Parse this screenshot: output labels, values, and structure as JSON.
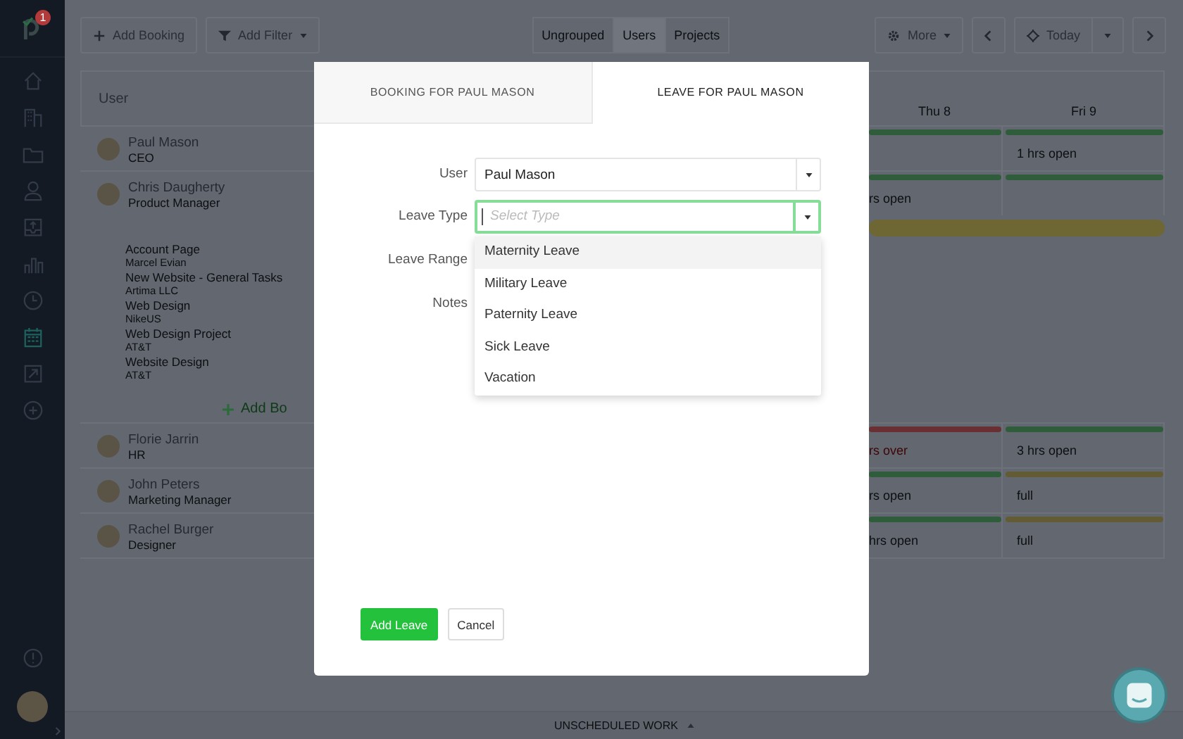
{
  "sidebar": {
    "badge": "1",
    "items": [
      {
        "kind": "home",
        "selected": false
      },
      {
        "kind": "building",
        "selected": false
      },
      {
        "kind": "folder",
        "selected": false
      },
      {
        "kind": "person",
        "selected": false
      },
      {
        "kind": "tray",
        "selected": false
      },
      {
        "kind": "chart",
        "selected": false
      },
      {
        "kind": "clock",
        "selected": false
      },
      {
        "kind": "calendar",
        "selected": true
      },
      {
        "kind": "arrow",
        "selected": false
      },
      {
        "kind": "plus",
        "selected": false
      }
    ]
  },
  "toolbar": {
    "add_booking": "Add Booking",
    "add_filter": "Add Filter",
    "grouping": [
      {
        "label": "Ungrouped",
        "selected": false
      },
      {
        "label": "Users",
        "selected": true
      },
      {
        "label": "Projects",
        "selected": false
      }
    ],
    "more": "More",
    "today": "Today"
  },
  "schedule": {
    "user_header": "User",
    "days": [
      "Thu 8",
      "Fri 9"
    ],
    "users": [
      {
        "name": "Paul Mason",
        "role": "CEO",
        "cells": [
          {
            "color": "#2f5c3a"
          },
          {
            "color": "#2f5c3a",
            "text": "1 hrs open"
          }
        ]
      },
      {
        "name": "Chris Daugherty",
        "role": "Product Manager",
        "cells": [
          {
            "color": "#2f5c3a",
            "text": "rs open"
          },
          {
            "color": "#2f5c3a"
          }
        ],
        "booking_bar": {
          "color": "#6e6633"
        },
        "projects": [
          {
            "name": "Account Page",
            "client": "Marcel Evian"
          },
          {
            "name": "New Website - General Tasks",
            "client": "Artima LLC"
          },
          {
            "name": "Web Design",
            "client": "NikeUS"
          },
          {
            "name": "Web Design Project",
            "client": "AT&T"
          },
          {
            "name": "Website Design",
            "client": "AT&T"
          }
        ],
        "add_booking": "Add Bo"
      },
      {
        "name": "Florie Jarrin",
        "role": "HR",
        "cells": [
          {
            "color": "#6a2f33",
            "text": "rs over",
            "kind": "over"
          },
          {
            "color": "#2f5c3a",
            "text": "3 hrs open"
          }
        ]
      },
      {
        "name": "John Peters",
        "role": "Marketing Manager",
        "cells": [
          {
            "color": "#2f5c3a",
            "text": "rs open"
          },
          {
            "color": "#625b34",
            "text": "full"
          }
        ]
      },
      {
        "name": "Rachel Burger",
        "role": "Designer",
        "cells": [
          {
            "color": "#2f5c3a",
            "text": "hrs open"
          },
          {
            "color": "#625b34",
            "text": "full"
          }
        ]
      }
    ]
  },
  "modal": {
    "tabs": [
      {
        "label": "BOOKING FOR PAUL MASON",
        "selected": false
      },
      {
        "label": "LEAVE FOR PAUL MASON",
        "selected": true
      }
    ],
    "fields": [
      {
        "label": "User",
        "kind": "select",
        "value": "Paul Mason"
      },
      {
        "label": "Leave Type",
        "kind": "select",
        "placeholder": "Select Type",
        "focused": true,
        "open": true,
        "options": [
          {
            "label": "Maternity Leave",
            "highlighted": true
          },
          {
            "label": "Military Leave",
            "highlighted": false
          },
          {
            "label": "Paternity Leave",
            "highlighted": false
          },
          {
            "label": "Sick Leave",
            "highlighted": false
          },
          {
            "label": "Vacation",
            "highlighted": false
          }
        ]
      },
      {
        "label": "Leave Range",
        "kind": "range"
      },
      {
        "label": "Notes",
        "kind": "notes"
      }
    ],
    "buttons": [
      {
        "label": "Add Leave",
        "kind": "primary"
      },
      {
        "label": "Cancel",
        "kind": "secondary"
      }
    ]
  },
  "footer": {
    "label": "UNSCHEDULED WORK"
  }
}
